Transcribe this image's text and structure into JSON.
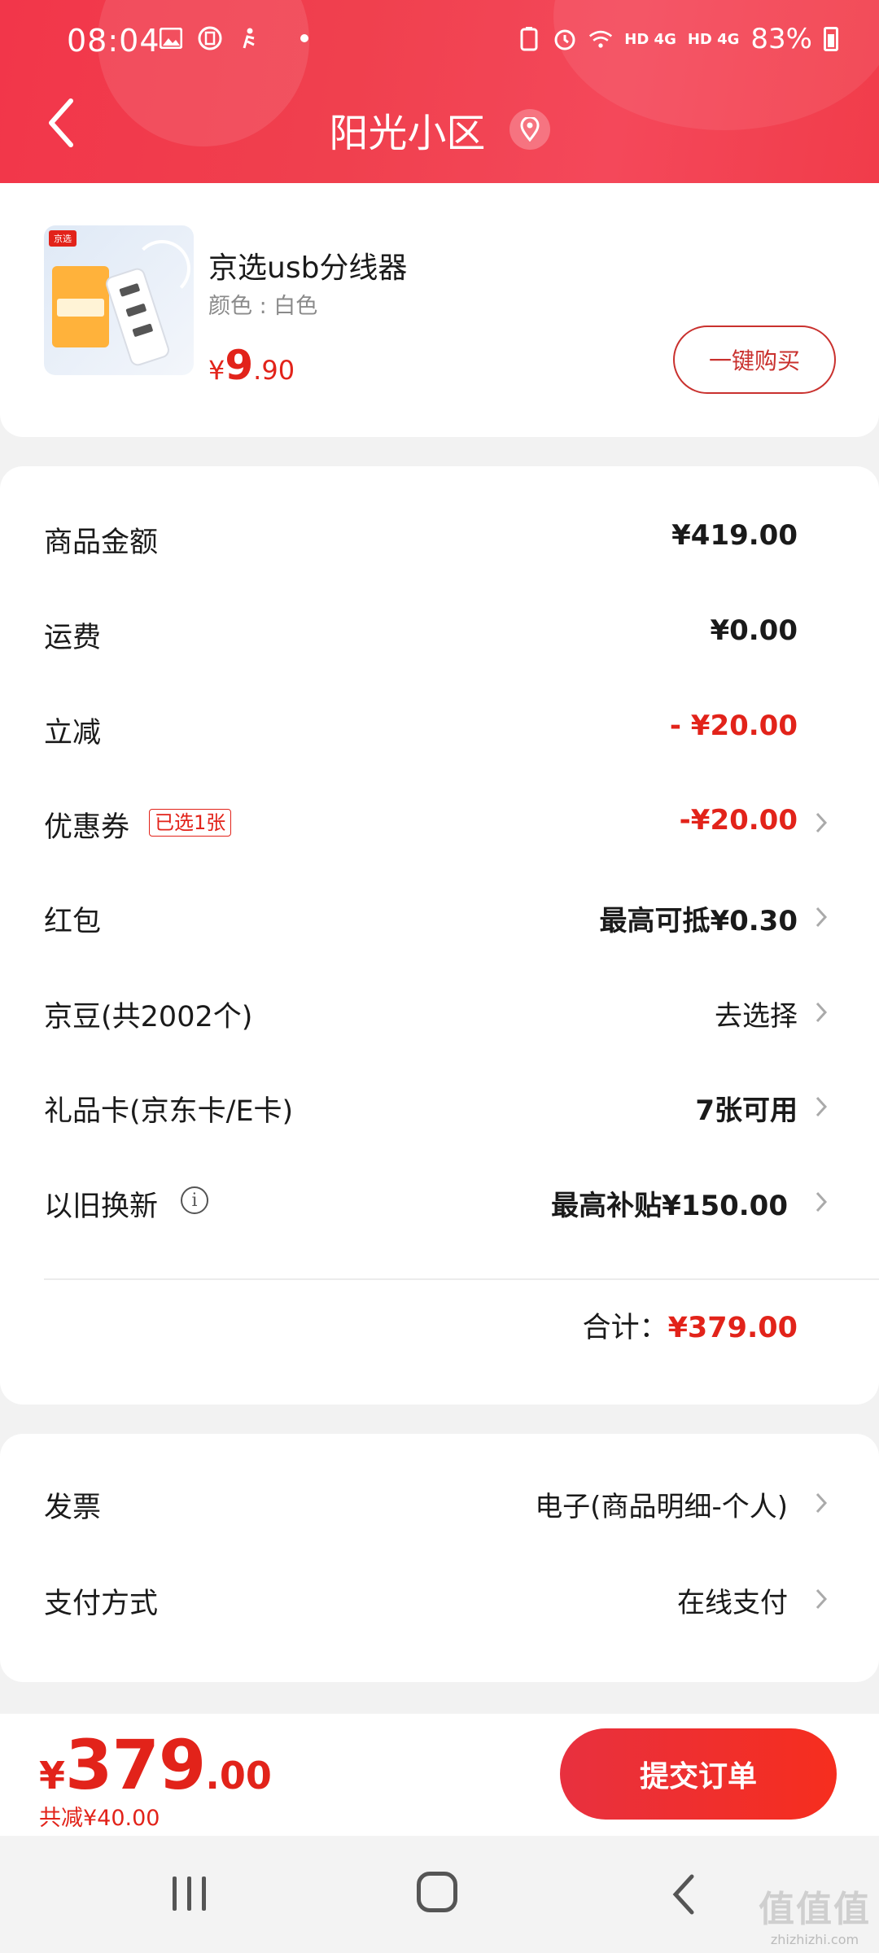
{
  "status_bar": {
    "time": "08:04",
    "network1": "HD 4G",
    "network2": "HD 4G",
    "battery": "83%"
  },
  "header": {
    "title": "阳光小区"
  },
  "product": {
    "name": "京选usb分线器",
    "attribute": "颜色 : 白色",
    "price_symbol": "¥",
    "price_int": "9",
    "price_dec": ".90",
    "image_tag": "京选",
    "buy_button": "一键购买"
  },
  "summary": {
    "rows": [
      {
        "label": "商品金额",
        "value": "¥419.00"
      },
      {
        "label": "运费",
        "value": "¥0.00"
      },
      {
        "label": "立减",
        "value": "- ¥20.00"
      },
      {
        "label": "优惠券",
        "tag": "已选1张",
        "value": "-¥20.00"
      },
      {
        "label": "红包",
        "value": "最高可抵¥0.30"
      },
      {
        "label": "京豆(共2002个)",
        "value": "去选择"
      },
      {
        "label": "礼品卡(京东卡/E卡)",
        "value": "7张可用"
      },
      {
        "label": "以旧换新",
        "value": "最高补贴¥150.00"
      }
    ],
    "total_label": "合计：",
    "total_value": "¥379.00"
  },
  "invoice": {
    "rows": [
      {
        "label": "发票",
        "value": "电子(商品明细-个人)"
      },
      {
        "label": "支付方式",
        "value": "在线支付"
      }
    ]
  },
  "bottom_bar": {
    "price_symbol": "¥",
    "price_int": "379",
    "price_dec": ".00",
    "saved": "共减¥40.00",
    "submit": "提交订单"
  },
  "watermark": {
    "big": "值值值",
    "small": "zhizhizhi.com"
  },
  "colors": {
    "brand_red": "#e2231a",
    "header_red": "#f2364a"
  }
}
